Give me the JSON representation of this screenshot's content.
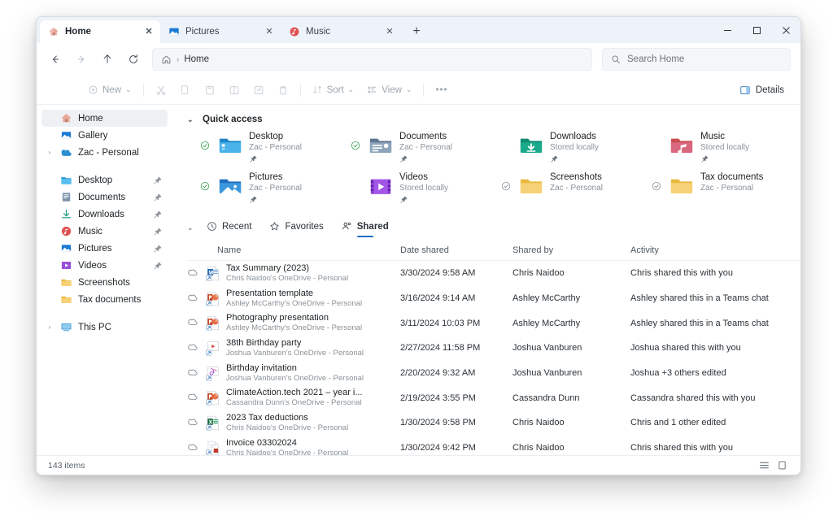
{
  "window": {
    "controls": {
      "minimize": "–",
      "maximize": "□",
      "close": "✕"
    }
  },
  "tabs": {
    "items": [
      {
        "label": "Home",
        "icon": "home-icon",
        "active": true,
        "close": "✕"
      },
      {
        "label": "Pictures",
        "icon": "pictures-icon",
        "active": false,
        "close": "✕"
      },
      {
        "label": "Music",
        "icon": "music-icon",
        "active": false,
        "close": "✕"
      }
    ],
    "new_tab": "+"
  },
  "address_bar": {
    "back": "←",
    "forward": "→",
    "up": "↑",
    "refresh": "⟳",
    "breadcrumb_home_icon": "home-icon",
    "breadcrumb_separator": "›",
    "breadcrumb_current": "Home"
  },
  "search": {
    "icon": "search-icon",
    "placeholder": "Search Home",
    "value": ""
  },
  "command_bar": {
    "new_label": "New",
    "new_chevron": "⌄",
    "cut": "cut-icon",
    "copy": "copy-icon",
    "paste": "paste-icon",
    "rename": "rename-icon",
    "share": "share-icon",
    "delete": "delete-icon",
    "sort_label": "Sort",
    "sort_chevron": "⌄",
    "view_label": "View",
    "view_chevron": "⌄",
    "more": "•••",
    "details_label": "Details"
  },
  "sidebar": {
    "top_items": [
      {
        "label": "Home",
        "icon": "home-icon",
        "selected": true,
        "chevron": "",
        "pinned": false
      },
      {
        "label": "Gallery",
        "icon": "gallery-icon",
        "selected": false,
        "chevron": "",
        "pinned": false
      },
      {
        "label": "Zac - Personal",
        "icon": "onedrive-icon",
        "selected": false,
        "chevron": "›",
        "pinned": false
      }
    ],
    "pinned_items": [
      {
        "label": "Desktop",
        "icon": "desktop-folder-icon",
        "pinned": true
      },
      {
        "label": "Documents",
        "icon": "documents-folder-icon",
        "pinned": true
      },
      {
        "label": "Downloads",
        "icon": "downloads-folder-icon",
        "pinned": true
      },
      {
        "label": "Music",
        "icon": "music-folder-icon",
        "pinned": true
      },
      {
        "label": "Pictures",
        "icon": "pictures-folder-icon",
        "pinned": true
      },
      {
        "label": "Videos",
        "icon": "videos-folder-icon",
        "pinned": true
      },
      {
        "label": "Screenshots",
        "icon": "folder-icon",
        "pinned": false
      },
      {
        "label": "Tax documents",
        "icon": "folder-icon",
        "pinned": false
      }
    ],
    "bottom_items": [
      {
        "label": "This PC",
        "icon": "this-pc-icon",
        "chevron": "›"
      }
    ]
  },
  "quick_access": {
    "title": "Quick access",
    "chevron": "⌄",
    "items": [
      {
        "name": "Desktop",
        "sub": "Zac - Personal",
        "icon": "desktop-folder-icon",
        "synced": true,
        "pinned": true
      },
      {
        "name": "Documents",
        "sub": "Zac - Personal",
        "icon": "documents-folder-icon",
        "synced": true,
        "pinned": true
      },
      {
        "name": "Downloads",
        "sub": "Stored locally",
        "icon": "downloads-folder-icon",
        "synced": false,
        "pinned": true
      },
      {
        "name": "Music",
        "sub": "Stored locally",
        "icon": "music-folder-icon",
        "synced": false,
        "pinned": true
      },
      {
        "name": "Pictures",
        "sub": "Zac - Personal",
        "icon": "pictures-folder-icon",
        "synced": true,
        "pinned": true
      },
      {
        "name": "Videos",
        "sub": "Stored locally",
        "icon": "videos-folder-icon",
        "synced": false,
        "pinned": true
      },
      {
        "name": "Screenshots",
        "sub": "Zac - Personal",
        "icon": "folder-icon",
        "synced": true,
        "pinned": false
      },
      {
        "name": "Tax documents",
        "sub": "Zac - Personal",
        "icon": "folder-icon",
        "synced": true,
        "pinned": false
      }
    ]
  },
  "view_tabs": {
    "chevron": "⌄",
    "items": [
      {
        "label": "Recent",
        "icon": "clock-icon",
        "active": false
      },
      {
        "label": "Favorites",
        "icon": "star-icon",
        "active": false
      },
      {
        "label": "Shared",
        "icon": "people-icon",
        "active": true
      }
    ]
  },
  "file_table": {
    "columns": [
      "Name",
      "Date shared",
      "Shared by",
      "Activity"
    ],
    "rows": [
      {
        "name": "Tax Summary (2023)",
        "location": "Chris Naidoo's OneDrive - Personal",
        "date_shared": "3/30/2024 9:58 AM",
        "shared_by": "Chris Naidoo",
        "activity": "Chris shared this with you",
        "icon": "word-doc-icon",
        "cloud": "cloud-icon"
      },
      {
        "name": "Presentation template",
        "location": "Ashley McCarthy's OneDrive - Personal",
        "date_shared": "3/16/2024 9:14 AM",
        "shared_by": "Ashley McCarthy",
        "activity": "Ashley shared this in a Teams chat",
        "icon": "powerpoint-doc-icon",
        "cloud": "cloud-icon"
      },
      {
        "name": "Photography presentation",
        "location": "Ashley McCarthy's OneDrive - Personal",
        "date_shared": "3/11/2024 10:03 PM",
        "shared_by": "Ashley McCarthy",
        "activity": "Ashley shared this in a Teams chat",
        "icon": "powerpoint-doc-icon",
        "cloud": "cloud-icon"
      },
      {
        "name": "38th Birthday party",
        "location": "Joshua Vanburen's OneDrive - Personal",
        "date_shared": "2/27/2024 11:58 PM",
        "shared_by": "Joshua Vanburen",
        "activity": "Joshua shared this with you",
        "icon": "video-file-icon",
        "cloud": "cloud-icon"
      },
      {
        "name": "Birthday invitation",
        "location": "Joshua Vanburen's OneDrive - Personal",
        "date_shared": "2/20/2024 9:32 AM",
        "shared_by": "Joshua Vanburen",
        "activity": "Joshua +3 others edited",
        "icon": "image-file-icon",
        "cloud": "cloud-icon"
      },
      {
        "name": "ClimateAction.tech 2021 – year i...",
        "location": "Cassandra Dunn's OneDrive - Personal",
        "date_shared": "2/19/2024 3:55 PM",
        "shared_by": "Cassandra Dunn",
        "activity": "Cassandra shared this with you",
        "icon": "powerpoint-doc-icon",
        "cloud": "cloud-icon"
      },
      {
        "name": "2023 Tax deductions",
        "location": "Chris Naidoo's OneDrive - Personal",
        "date_shared": "1/30/2024 9:58 PM",
        "shared_by": "Chris Naidoo",
        "activity": "Chris and 1 other edited",
        "icon": "excel-doc-icon",
        "cloud": "cloud-icon"
      },
      {
        "name": "Invoice 03302024",
        "location": "Chris Naidoo's OneDrive - Personal",
        "date_shared": "1/30/2024 9:42 PM",
        "shared_by": "Chris Naidoo",
        "activity": "Chris shared this with you",
        "icon": "pdf-file-icon",
        "cloud": "cloud-icon"
      }
    ]
  },
  "status_bar": {
    "item_count": "143 items",
    "list_view": "list-view-icon",
    "details_view": "details-view-icon"
  },
  "colors": {
    "accent": "#1a6fc4",
    "tabstrip": "#eef3f9",
    "sync_green": "#2f9e44",
    "folder_yellow": "#f5cb5c"
  }
}
